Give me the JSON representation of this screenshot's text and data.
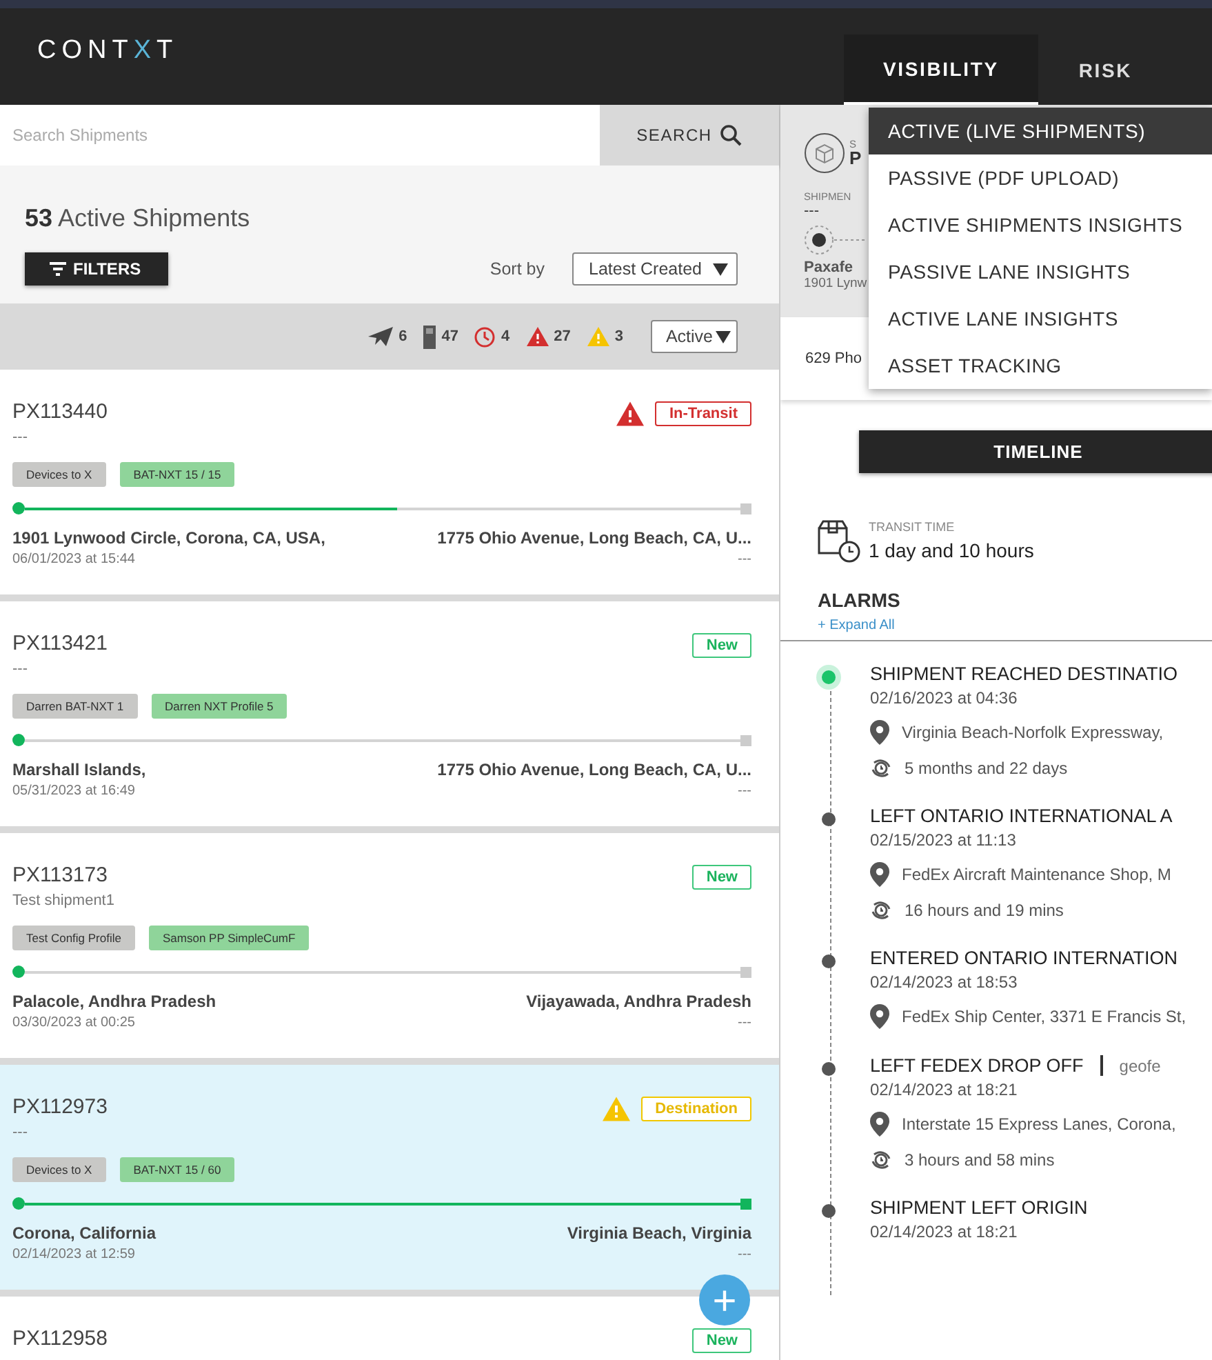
{
  "header": {
    "logo_left": "CONT",
    "logo_accent": "X",
    "logo_right": "T",
    "nav": [
      {
        "label": "VISIBILITY",
        "selected": true
      },
      {
        "label": "RISK",
        "selected": false
      }
    ]
  },
  "dropdown": [
    {
      "label": "ACTIVE (LIVE SHIPMENTS)",
      "selected": true
    },
    {
      "label": "PASSIVE (PDF UPLOAD)",
      "selected": false
    },
    {
      "label": "ACTIVE SHIPMENTS INSIGHTS",
      "selected": false
    },
    {
      "label": "PASSIVE LANE INSIGHTS",
      "selected": false
    },
    {
      "label": "ACTIVE LANE INSIGHTS",
      "selected": false
    },
    {
      "label": "ASSET TRACKING",
      "selected": false
    }
  ],
  "search": {
    "placeholder": "Search Shipments",
    "button": "SEARCH"
  },
  "summary": {
    "count": "53",
    "label": "Active Shipments",
    "filters_button": "FILTERS",
    "sort_label": "Sort by",
    "sort_value": "Latest Created"
  },
  "stats": [
    {
      "kind": "plane",
      "count": "6"
    },
    {
      "kind": "device",
      "count": "47"
    },
    {
      "kind": "clock",
      "count": "4"
    },
    {
      "kind": "critical",
      "count": "27"
    },
    {
      "kind": "warning",
      "count": "3"
    }
  ],
  "status_filter": "Active",
  "shipments": [
    {
      "id": "PX113440",
      "subtitle": "---",
      "alert": {
        "color": "#d32f2f"
      },
      "status": {
        "label": "In-Transit",
        "kind": "in-transit"
      },
      "tags": [
        {
          "label": "Devices to X",
          "kind": "profile"
        },
        {
          "label": "BAT-NXT 15 / 15",
          "kind": "device"
        }
      ],
      "level": 0.52,
      "origin": "1901 Lynwood Circle, Corona, CA, USA,",
      "origin_time": "06/01/2023 at 15:44",
      "destination": "1775 Ohio Avenue, Long Beach, CA, U...",
      "destination_time": "---",
      "selected": false
    },
    {
      "id": "PX113421",
      "subtitle": "---",
      "status": {
        "label": "New",
        "kind": "new"
      },
      "tags": [
        {
          "label": "Darren BAT-NXT 1",
          "kind": "profile"
        },
        {
          "label": "Darren NXT Profile 5",
          "kind": "device"
        }
      ],
      "level": 0,
      "origin": "Marshall Islands,",
      "origin_time": "05/31/2023 at 16:49",
      "destination": "1775 Ohio Avenue, Long Beach, CA, U...",
      "destination_time": "---",
      "selected": false
    },
    {
      "id": "PX113173",
      "subtitle": "Test shipment1",
      "status": {
        "label": "New",
        "kind": "new"
      },
      "tags": [
        {
          "label": "Test Config Profile",
          "kind": "profile"
        },
        {
          "label": "Samson PP SimpleCumF",
          "kind": "device"
        }
      ],
      "level": 0,
      "origin": "Palacole, Andhra Pradesh",
      "origin_time": "03/30/2023 at 00:25",
      "destination": "Vijayawada, Andhra Pradesh",
      "destination_time": "---",
      "selected": false
    },
    {
      "id": "PX112973",
      "subtitle": "---",
      "alert": {
        "color": "#f5c400"
      },
      "status": {
        "label": "Destination",
        "kind": "destination"
      },
      "tags": [
        {
          "label": "Devices to X",
          "kind": "profile"
        },
        {
          "label": "BAT-NXT 15 / 60",
          "kind": "device"
        }
      ],
      "level": 1,
      "origin": "Corona, California",
      "origin_time": "02/14/2023 at 12:59",
      "destination": "Virginia Beach, Virginia",
      "destination_time": "---",
      "selected": true
    },
    {
      "id": "PX112958",
      "status": {
        "label": "New",
        "kind": "new"
      },
      "selected": false
    }
  ],
  "fab": "+",
  "detail": {
    "type_label": "S",
    "name": "P",
    "field_label": "SHIPMEN",
    "field_value": "---",
    "origin_name": "Paxafe",
    "origin_address": "1901 Lynw",
    "address": "629 Pho"
  },
  "timeline": {
    "button": "TIMELINE",
    "transit_label": "TRANSIT TIME",
    "transit_value": "1 day and 10 hours",
    "alarms_title": "ALARMS",
    "expand_link": "+ Expand All",
    "events": [
      {
        "title": "SHIPMENT REACHED DESTINATIO",
        "date": "02/16/2023 at 04:36",
        "location": "Virginia Beach-Norfolk Expressway,",
        "duration": "5 months and 22 days",
        "current": true
      },
      {
        "title": "LEFT ONTARIO INTERNATIONAL A",
        "date": "02/15/2023 at 11:13",
        "location": "FedEx Aircraft Maintenance Shop, M",
        "duration": "16 hours and 19 mins",
        "current": false
      },
      {
        "title": "ENTERED ONTARIO INTERNATION",
        "date": "02/14/2023 at 18:53",
        "location": "FedEx Ship Center, 3371 E Francis St,",
        "current": false
      },
      {
        "title": "LEFT FEDEX DROP OFF",
        "geofence": "geofe",
        "date": "02/14/2023 at 18:21",
        "location": "Interstate 15 Express Lanes, Corona,",
        "duration": "3 hours and 58 mins",
        "current": false
      },
      {
        "title": "SHIPMENT LEFT ORIGIN",
        "date": "02/14/2023 at 18:21",
        "current": false
      }
    ]
  }
}
